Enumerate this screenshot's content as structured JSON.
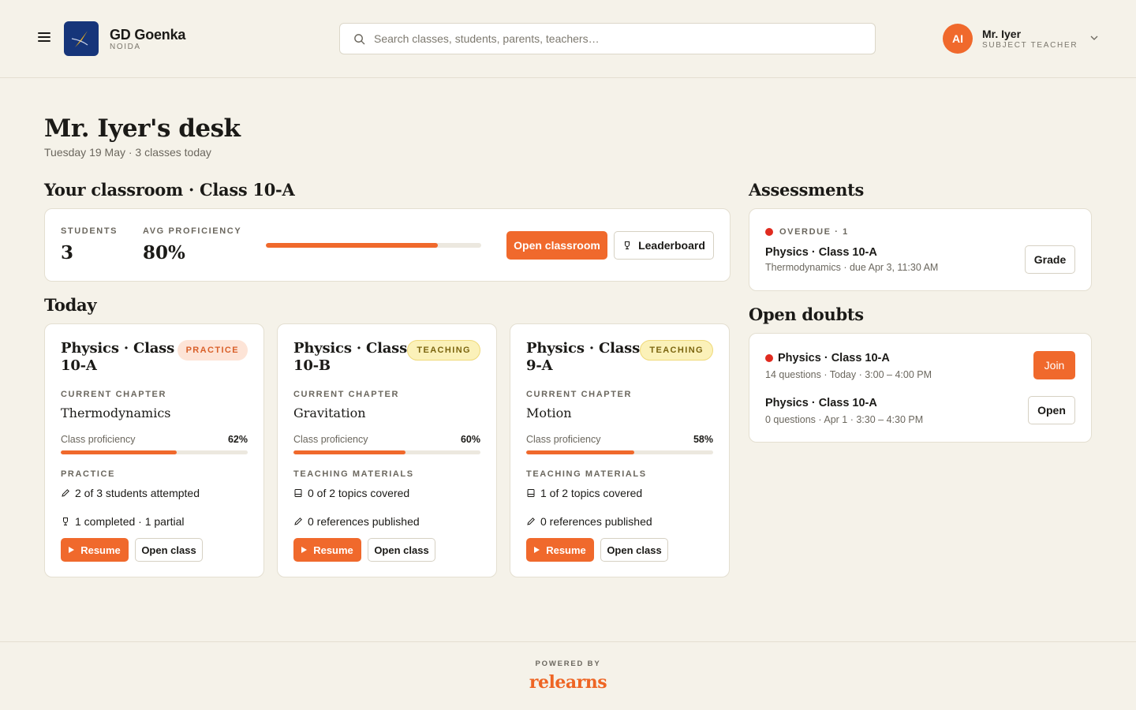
{
  "header": {
    "school_name": "GD Goenka",
    "school_location": "NOIDA",
    "search_placeholder": "Search classes, students, parents, teachers…",
    "user": {
      "initials": "AI",
      "name": "Mr. Iyer",
      "role": "SUBJECT TEACHER"
    }
  },
  "page": {
    "title": "Mr. Iyer's desk",
    "subtitle": "Tuesday 19 May · 3 classes today"
  },
  "classroom": {
    "heading": "Your classroom · Class 10-A",
    "students_label": "STUDENTS",
    "students_value": "3",
    "proficiency_label": "AVG PROFICIENCY",
    "proficiency_value": "80%",
    "proficiency_fraction": 0.8,
    "open_button": "Open classroom",
    "leaderboard_button": "Leaderboard"
  },
  "today": {
    "heading": "Today",
    "classes": [
      {
        "title": "Physics · Class 10-A",
        "badge": "PRACTICE",
        "badge_type": "practice",
        "chapter_label": "CURRENT CHAPTER",
        "chapter": "Thermodynamics",
        "proficiency_label": "Class proficiency",
        "proficiency_value": "62%",
        "proficiency_fraction": 0.62,
        "section_label": "PRACTICE",
        "line1": "2 of 3 students attempted",
        "line1_icon": "pencil-icon",
        "line2": "1 completed · 1 partial",
        "line2_icon": "trophy-icon",
        "resume": "Resume",
        "open": "Open class"
      },
      {
        "title": "Physics · Class 10-B",
        "badge": "TEACHING",
        "badge_type": "teaching",
        "chapter_label": "CURRENT CHAPTER",
        "chapter": "Gravitation",
        "proficiency_label": "Class proficiency",
        "proficiency_value": "60%",
        "proficiency_fraction": 0.6,
        "section_label": "TEACHING MATERIALS",
        "line1": "0 of 2 topics covered",
        "line1_icon": "book-icon",
        "line2": "0 references published",
        "line2_icon": "pencil-icon",
        "resume": "Resume",
        "open": "Open class"
      },
      {
        "title": "Physics · Class 9-A",
        "badge": "TEACHING",
        "badge_type": "teaching",
        "chapter_label": "CURRENT CHAPTER",
        "chapter": "Motion",
        "proficiency_label": "Class proficiency",
        "proficiency_value": "58%",
        "proficiency_fraction": 0.58,
        "section_label": "TEACHING MATERIALS",
        "line1": "1 of 2 topics covered",
        "line1_icon": "book-icon",
        "line2": "0 references published",
        "line2_icon": "pencil-icon",
        "resume": "Resume",
        "open": "Open class"
      }
    ]
  },
  "assessments": {
    "heading": "Assessments",
    "overdue_label": "OVERDUE · 1",
    "item_title": "Physics · Class 10-A",
    "item_meta": "Thermodynamics · due Apr 3, 11:30 AM",
    "grade_button": "Grade"
  },
  "doubts": {
    "heading": "Open doubts",
    "items": [
      {
        "title": "Physics · Class 10-A",
        "meta": "14 questions · Today · 3:00 – 4:00 PM",
        "button": "Join",
        "live": true
      },
      {
        "title": "Physics · Class 10-A",
        "meta": "0 questions · Apr 1 · 3:30 – 4:30 PM",
        "button": "Open",
        "live": false
      }
    ]
  },
  "footer": {
    "powered_by": "POWERED BY",
    "brand": "relearns"
  },
  "colors": {
    "accent": "#f0692c",
    "background": "#f5f2e9",
    "overdue": "#e02b1f",
    "logo_bg": "#16357a"
  }
}
